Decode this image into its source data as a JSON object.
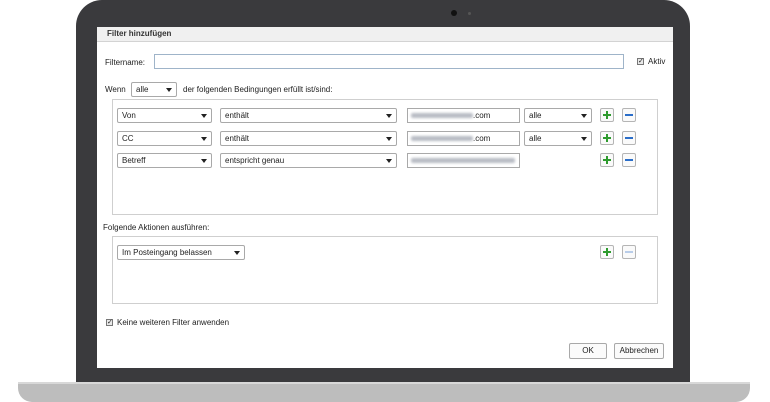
{
  "dialog": {
    "title": "Filter hinzufügen",
    "filtername_label": "Filtername:",
    "filtername_value": "",
    "active_label": "Aktiv",
    "active_checked": true
  },
  "conditions": {
    "prefix": "Wenn",
    "match_mode": "alle",
    "suffix": "der folgenden Bedingungen erfüllt ist/sind:",
    "rows": [
      {
        "field": "Von",
        "operator": "enthält",
        "value_suffix": ".com",
        "scope": "alle",
        "has_scope": true
      },
      {
        "field": "CC",
        "operator": "enthält",
        "value_suffix": ".com",
        "scope": "alle",
        "has_scope": true
      },
      {
        "field": "Betreff",
        "operator": "entspricht genau",
        "value_suffix": "",
        "scope": "",
        "has_scope": false
      }
    ]
  },
  "actions": {
    "label": "Folgende Aktionen ausführen:",
    "rows": [
      {
        "action": "Im Posteingang belassen"
      }
    ]
  },
  "footer": {
    "stop_label": "Keine weiteren Filter anwenden",
    "stop_checked": true,
    "ok_label": "OK",
    "cancel_label": "Abbrechen"
  },
  "icons": {
    "add": "plus-icon",
    "remove": "minus-icon",
    "dropdown": "chevron-down-icon",
    "checkbox": "checkmark-icon"
  },
  "colors": {
    "plus": "#2e9b2e",
    "minus": "#2b6ec9",
    "bezel": "#3a3a3d",
    "input_border": "#9fb4c9"
  }
}
